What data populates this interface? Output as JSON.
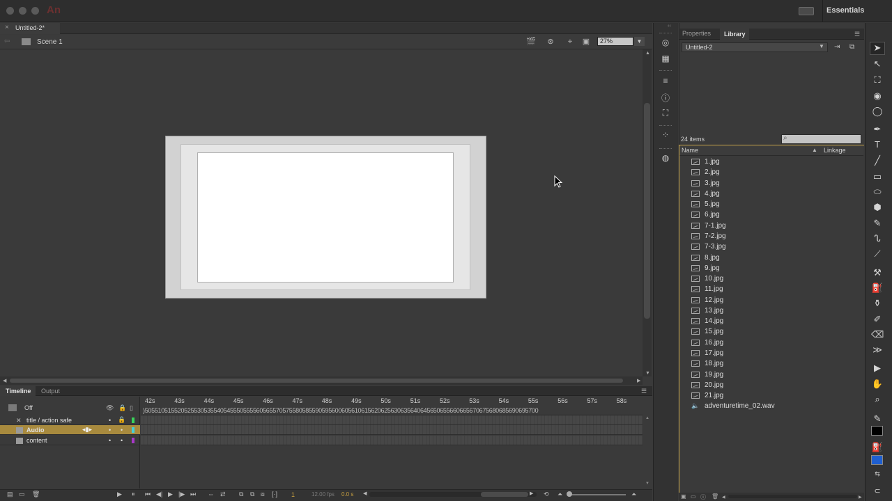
{
  "app": {
    "logo": "An",
    "workspace": "Essentials"
  },
  "document": {
    "tab_title": "Untitled-2*",
    "close_glyph": "×",
    "scene_label": "Scene 1",
    "zoom": "27%"
  },
  "timeline": {
    "tabs": [
      "Timeline",
      "Output"
    ],
    "onion_label": "Off",
    "seconds": [
      "42s",
      "43s",
      "44s",
      "45s",
      "46s",
      "47s",
      "48s",
      "49s",
      "50s",
      "51s",
      "52s",
      "53s",
      "54s",
      "55s",
      "56s",
      "57s",
      "58s"
    ],
    "frame_ticks": ")505510515520525530535540545550555560565570575580585590595600605610615620625630635640645650655660665670675680685690695700",
    "layers": [
      {
        "name": "title / action safe",
        "selected": false,
        "color": "#39d35a",
        "type": "guide"
      },
      {
        "name": "Audio",
        "selected": true,
        "color": "#45d0d8",
        "type": "normal"
      },
      {
        "name": "content",
        "selected": false,
        "color": "#a838c8",
        "type": "normal"
      }
    ],
    "current_frame": "1",
    "fps": "12.00 fps",
    "time": "0.0 s"
  },
  "library": {
    "tabs": [
      "Properties",
      "Library"
    ],
    "document": "Untitled-2",
    "item_count": "24 items",
    "col_name": "Name",
    "col_linkage": "Linkage",
    "items": [
      {
        "name": "1.jpg",
        "icon": "image-icon"
      },
      {
        "name": "2.jpg",
        "icon": "image-icon"
      },
      {
        "name": "3.jpg",
        "icon": "image-icon"
      },
      {
        "name": "4.jpg",
        "icon": "image-icon"
      },
      {
        "name": "5.jpg",
        "icon": "image-icon"
      },
      {
        "name": "6.jpg",
        "icon": "image-icon"
      },
      {
        "name": "7-1.jpg",
        "icon": "image-icon"
      },
      {
        "name": "7-2.jpg",
        "icon": "image-icon"
      },
      {
        "name": "7-3.jpg",
        "icon": "image-icon"
      },
      {
        "name": "8.jpg",
        "icon": "image-icon"
      },
      {
        "name": "9.jpg",
        "icon": "image-icon"
      },
      {
        "name": "10.jpg",
        "icon": "image-icon"
      },
      {
        "name": "11.jpg",
        "icon": "image-icon"
      },
      {
        "name": "12.jpg",
        "icon": "image-icon"
      },
      {
        "name": "13.jpg",
        "icon": "image-icon"
      },
      {
        "name": "14.jpg",
        "icon": "image-icon"
      },
      {
        "name": "15.jpg",
        "icon": "image-icon"
      },
      {
        "name": "16.jpg",
        "icon": "image-icon"
      },
      {
        "name": "17.jpg",
        "icon": "image-icon"
      },
      {
        "name": "18.jpg",
        "icon": "image-icon"
      },
      {
        "name": "19.jpg",
        "icon": "image-icon"
      },
      {
        "name": "20.jpg",
        "icon": "image-icon"
      },
      {
        "name": "21.jpg",
        "icon": "image-icon"
      },
      {
        "name": "adventuretime_02.wav",
        "icon": "sound-icon"
      }
    ]
  },
  "colors": {
    "accent": "#c9a64a",
    "selected_layer": "#a88a3e",
    "fill_color": "#1f5fd0",
    "stroke_color": "#000000"
  }
}
